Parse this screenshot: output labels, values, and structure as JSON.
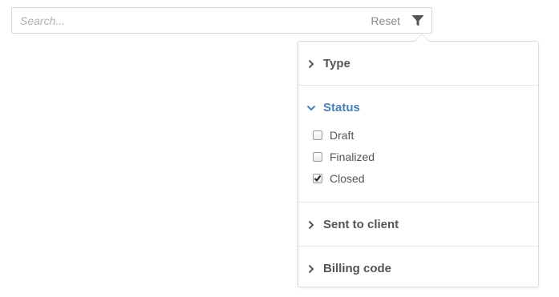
{
  "search": {
    "placeholder": "Search...",
    "value": "",
    "reset_label": "Reset",
    "filter_icon": "filter-icon"
  },
  "filter_panel": {
    "sections": [
      {
        "title": "Type",
        "expanded": false
      },
      {
        "title": "Status",
        "expanded": true,
        "options": [
          {
            "label": "Draft",
            "checked": false
          },
          {
            "label": "Finalized",
            "checked": false
          },
          {
            "label": "Closed",
            "checked": true
          }
        ]
      },
      {
        "title": "Sent to client",
        "expanded": false
      },
      {
        "title": "Billing code",
        "expanded": false
      }
    ]
  },
  "colors": {
    "accent": "#4a7fb5",
    "text": "#555555",
    "border": "#dadada"
  }
}
